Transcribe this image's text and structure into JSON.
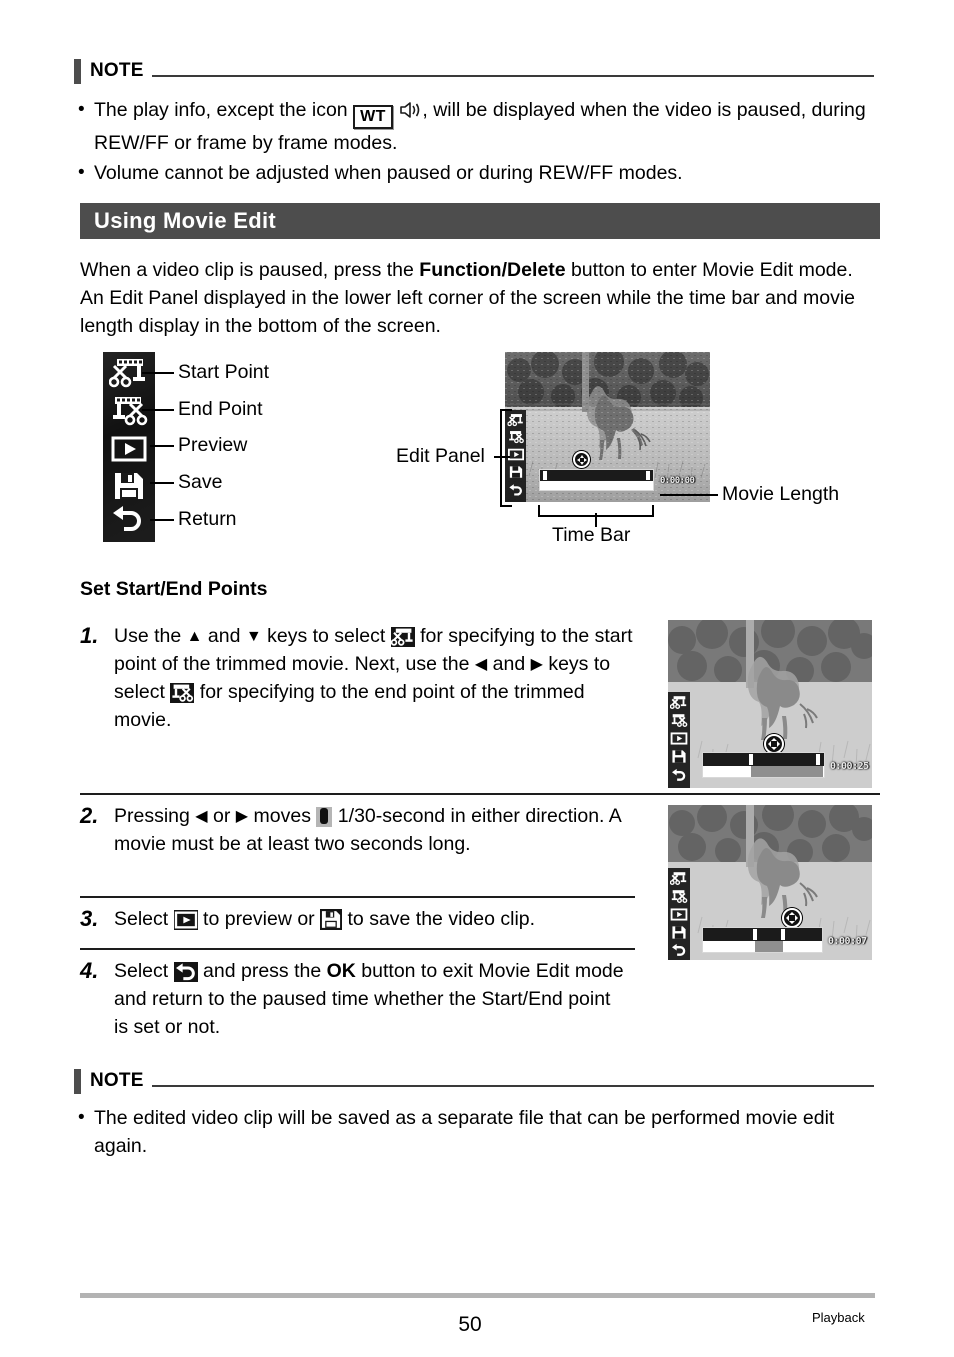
{
  "note_top": {
    "label": "NOTE",
    "bullets": [
      {
        "part1": "The play info, except the icon",
        "icon_wt": "WT",
        "icon_speaker": "speaker-icon",
        "part2": ", will be displayed when the video is paused, during REW/FF or frame by frame modes."
      },
      {
        "part1": "Volume cannot be adjusted when paused or during REW/FF modes."
      }
    ]
  },
  "section": {
    "title": "Using Movie Edit",
    "intro_a": "When a video clip is paused, press the ",
    "intro_bold": "Function/Delete",
    "intro_b": " button to enter Movie Edit mode. An Edit Panel displayed in the lower left corner of the screen while the time bar and movie length display in the bottom of the screen."
  },
  "legend": {
    "items": [
      {
        "label": "Start Point",
        "icon": "start-point-icon"
      },
      {
        "label": "End Point",
        "icon": "end-point-icon"
      },
      {
        "label": "Preview",
        "icon": "preview-icon"
      },
      {
        "label": "Save",
        "icon": "save-icon"
      },
      {
        "label": "Return",
        "icon": "return-icon"
      }
    ]
  },
  "diagram_callouts": {
    "edit_panel": "Edit Panel",
    "movie_length": "Movie Length",
    "time_bar": "Time Bar"
  },
  "camera_screens": {
    "diagram": {
      "movie_length": "0:00:00"
    },
    "step1": {
      "movie_length": "0:00:25"
    },
    "step2": {
      "movie_length": "0:00:07"
    }
  },
  "steps_heading": "Set Start/End Points",
  "steps": [
    {
      "num": "1.",
      "text_a": "Use the ",
      "key_up": "▲",
      "text_b": " and ",
      "key_down": "▼",
      "text_c": " keys to select ",
      "icon1": "start-point-icon",
      "text_d": " for specifying to the start point of the trimmed movie. Next, use the ",
      "key_left": "◀",
      "text_e": " and ",
      "key_right": "▶",
      "text_f": " keys to select ",
      "icon2": "end-point-icon",
      "text_g": " for specifying to the end point of the trimmed movie."
    },
    {
      "num": "2.",
      "text_a": "Pressing ",
      "key_left": "◀",
      "text_b": " or ",
      "key_right": "▶",
      "text_c": " moves ",
      "icon1": "time-cursor-icon",
      "text_d": " 1/30-second in either direction. A movie must be at least two seconds long."
    },
    {
      "num": "3.",
      "text_a": "Select ",
      "icon1": "preview-icon",
      "text_b": " to preview or ",
      "icon2": "save-icon",
      "text_c": " to save the video clip."
    },
    {
      "num": "4.",
      "text_a": "Select ",
      "icon1": "return-icon",
      "text_b": " and press the ",
      "bold_ok": "OK",
      "text_c": " button to exit Movie Edit mode and return to the paused time whether the Start/End point is set or not."
    }
  ],
  "note_bottom": {
    "label": "NOTE",
    "bullets": [
      {
        "part1": "The edited video clip will be saved as a separate file that can be performed movie edit again."
      }
    ]
  },
  "footer": {
    "page_number": "50",
    "section_tag": "Playback"
  },
  "colors": {
    "section_bar": "#4d4d4d",
    "note_bar": "#4d4d4d",
    "footer_rule": "#b3b3b3",
    "text": "#000000"
  }
}
